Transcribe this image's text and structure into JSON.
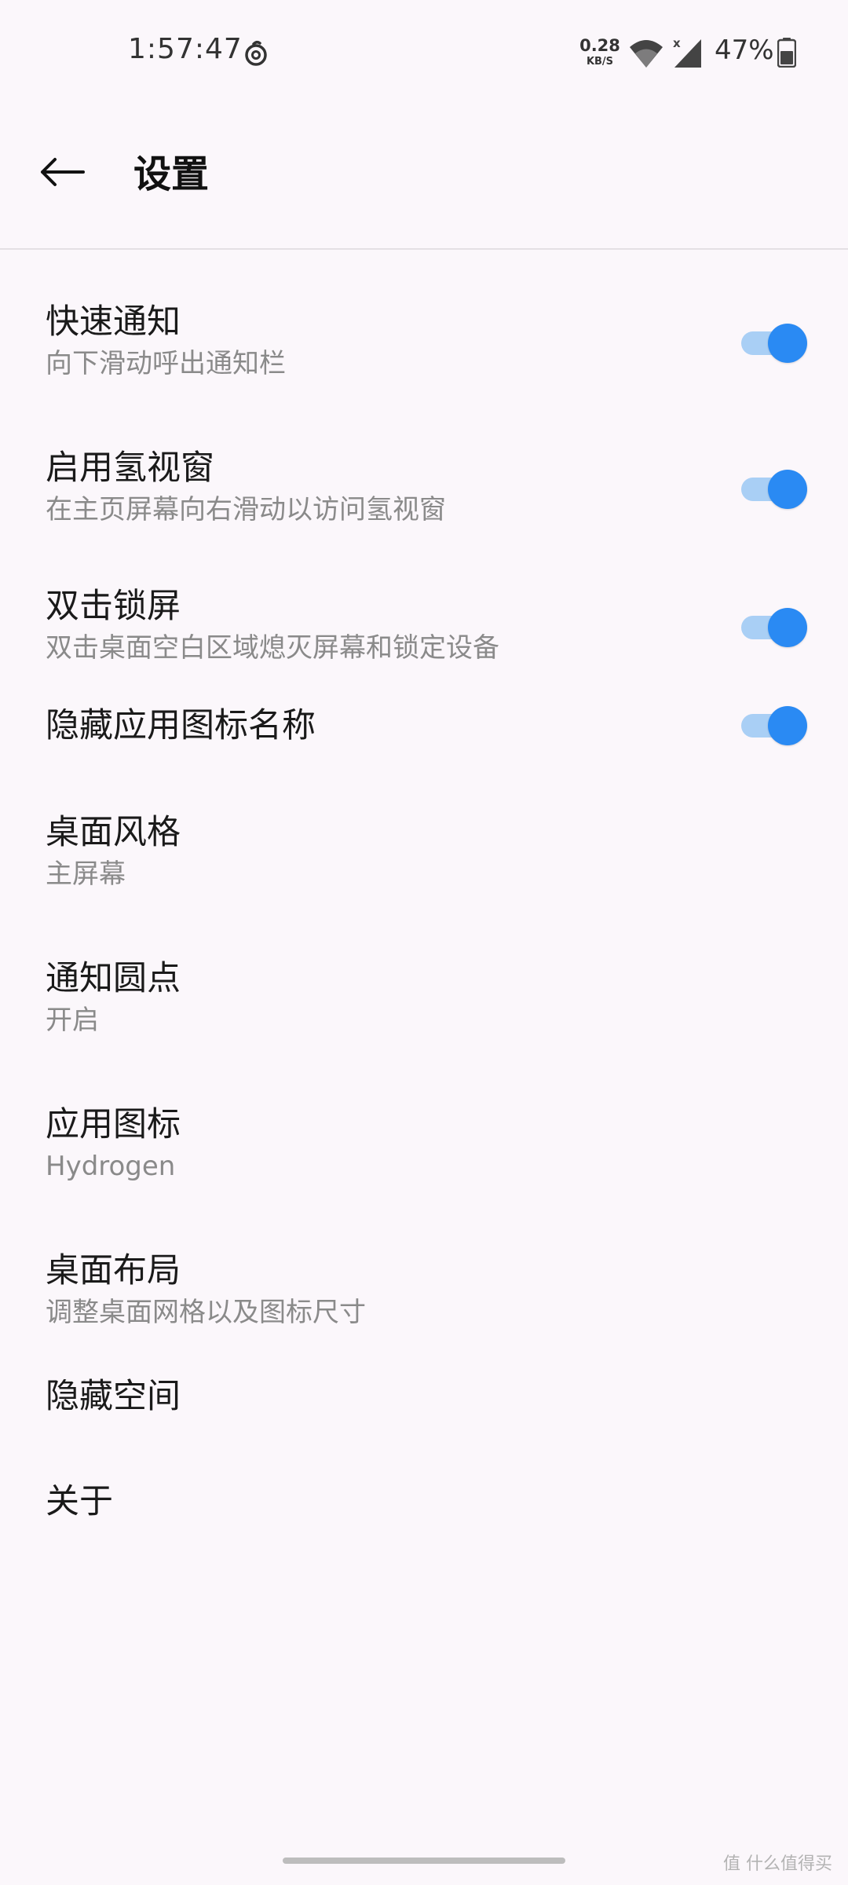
{
  "status_bar": {
    "time": "1:57:47",
    "net_speed_value": "0.28",
    "net_speed_unit": "KB/S",
    "battery_percent": "47%",
    "icons": [
      "netease-music-icon",
      "wifi-icon",
      "signal-icon",
      "battery-icon"
    ]
  },
  "header": {
    "title": "设置",
    "back_icon": "arrow-left-icon"
  },
  "settings": [
    {
      "title": "快速通知",
      "subtitle": "向下滑动呼出通知栏",
      "toggle": true
    },
    {
      "title": "启用氢视窗",
      "subtitle": "在主页屏幕向右滑动以访问氢视窗",
      "toggle": true
    },
    {
      "title": "双击锁屏",
      "subtitle": "双击桌面空白区域熄灭屏幕和锁定设备",
      "toggle": true
    },
    {
      "title": "隐藏应用图标名称",
      "toggle": true
    },
    {
      "title": "桌面风格",
      "subtitle": "主屏幕"
    },
    {
      "title": "通知圆点",
      "subtitle": "开启"
    },
    {
      "title": "应用图标",
      "subtitle": "Hydrogen"
    },
    {
      "title": "桌面布局",
      "subtitle": "调整桌面网格以及图标尺寸"
    },
    {
      "title": "隐藏空间"
    },
    {
      "title": "关于"
    }
  ],
  "colors": {
    "background": "#fbf7fb",
    "toggle_thumb": "#2a8af3",
    "toggle_track": "#a9cff5"
  },
  "watermark": "值 什么值得买"
}
